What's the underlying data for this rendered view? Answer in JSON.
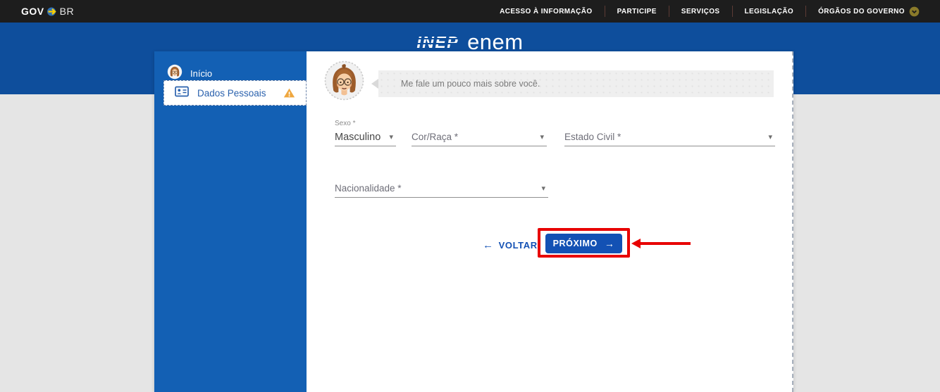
{
  "topbar": {
    "logo": {
      "gov": "GOV",
      "br": "BR"
    },
    "menu": [
      {
        "label": "ACESSO À INFORMAÇÃO"
      },
      {
        "label": "PARTICIPE"
      },
      {
        "label": "SERVIÇOS"
      },
      {
        "label": "LEGISLAÇÃO"
      },
      {
        "label": "ÓRGÃOS DO GOVERNO"
      }
    ]
  },
  "banner": {
    "inep": "INEP",
    "enem": "enem"
  },
  "wizard": {
    "steps": [
      {
        "label": "Início",
        "active": false
      },
      {
        "label": "Dados Pessoais",
        "active": true,
        "warning": true
      }
    ]
  },
  "assistant": {
    "message": "Me fale um pouco mais sobre você."
  },
  "form": {
    "sexo": {
      "label": "Sexo *",
      "value": "Masculino"
    },
    "cor_raca": {
      "label": "Cor/Raça *",
      "value": ""
    },
    "estado_civil": {
      "label": "Estado Civil *",
      "value": ""
    },
    "nacionalidade": {
      "label": "Nacionalidade *",
      "value": ""
    }
  },
  "actions": {
    "back": "VOLTAR",
    "next": "PRÓXIMO"
  },
  "icons": {
    "back_arrow": "←",
    "next_arrow": "→",
    "caret_down": "▾"
  },
  "colors": {
    "primary_blue": "#1351b4",
    "banner_blue": "#0e4e9c",
    "sidebar_blue": "#1360b4",
    "topbar_black": "#1d1d1d",
    "warning_orange": "#efa73f",
    "annotation_red": "#e80000",
    "page_grey": "#e5e5e5",
    "bubble_grey": "#efefef"
  }
}
